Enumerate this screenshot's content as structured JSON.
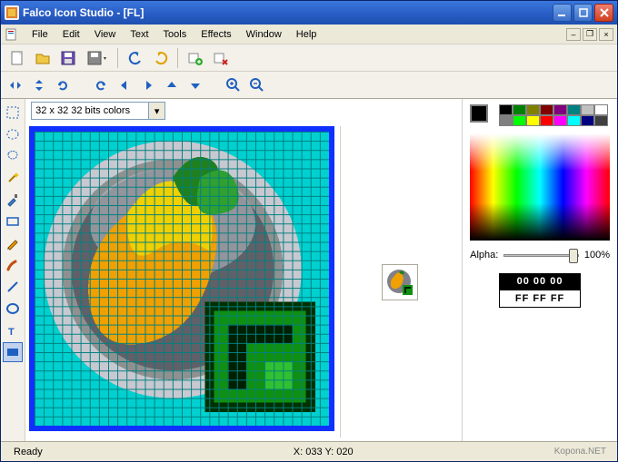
{
  "title": "Falco Icon Studio - [FL]",
  "menu": [
    "File",
    "Edit",
    "View",
    "Text",
    "Tools",
    "Effects",
    "Window",
    "Help"
  ],
  "format_selected": "32 x 32 32 bits colors",
  "alpha": {
    "label": "Alpha:",
    "value": "100%"
  },
  "hex": {
    "fg": "00 00 00",
    "bg": "FF FF FF"
  },
  "status": {
    "ready": "Ready",
    "coords": "X: 033 Y: 020"
  },
  "watermark": "Kopona.NET",
  "palette": [
    "#000000",
    "#008000",
    "#808000",
    "#800000",
    "#800080",
    "#008080",
    "#c0c0c0",
    "#ffffff",
    "#808080",
    "#00ff00",
    "#ffff00",
    "#ff0000",
    "#ff00ff",
    "#00ffff",
    "#000080",
    "#404040"
  ]
}
